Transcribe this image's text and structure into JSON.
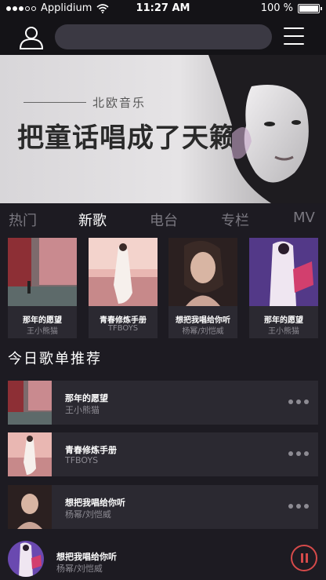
{
  "status_bar": {
    "carrier": "Applidium",
    "time": "11:27 AM",
    "battery": "100 %"
  },
  "header": {
    "icons": [
      "user-icon",
      "menu-icon"
    ]
  },
  "banner": {
    "subtitle": "北欧音乐",
    "headline": "把童话唱成了天籁"
  },
  "tabs": [
    "热门",
    "新歌",
    "电台",
    "专栏",
    "MV"
  ],
  "active_tab": "新歌",
  "new_songs": [
    {
      "title": "那年的愿望",
      "artist": "王小熊猫"
    },
    {
      "title": "青春修炼手册",
      "artist": "TFBOYS"
    },
    {
      "title": "想把我唱给你听",
      "artist": "杨幂/刘恺威"
    },
    {
      "title": "那年的愿望",
      "artist": "王小熊猫"
    }
  ],
  "section_title": "今日歌单推荐",
  "playlist": [
    {
      "title": "那年的愿望",
      "artist": "王小熊猫"
    },
    {
      "title": "青春修炼手册",
      "artist": "TFBOYS"
    },
    {
      "title": "想把我唱给你听",
      "artist": "杨幂/刘恺威"
    }
  ],
  "now_playing": {
    "title": "想把我唱给你听",
    "artist": "杨幂/刘恺威"
  },
  "colors": {
    "background": "#1d1b22",
    "card": "#2b2931",
    "accent": "#d64a4a",
    "muted_text": "#8d8b93"
  }
}
